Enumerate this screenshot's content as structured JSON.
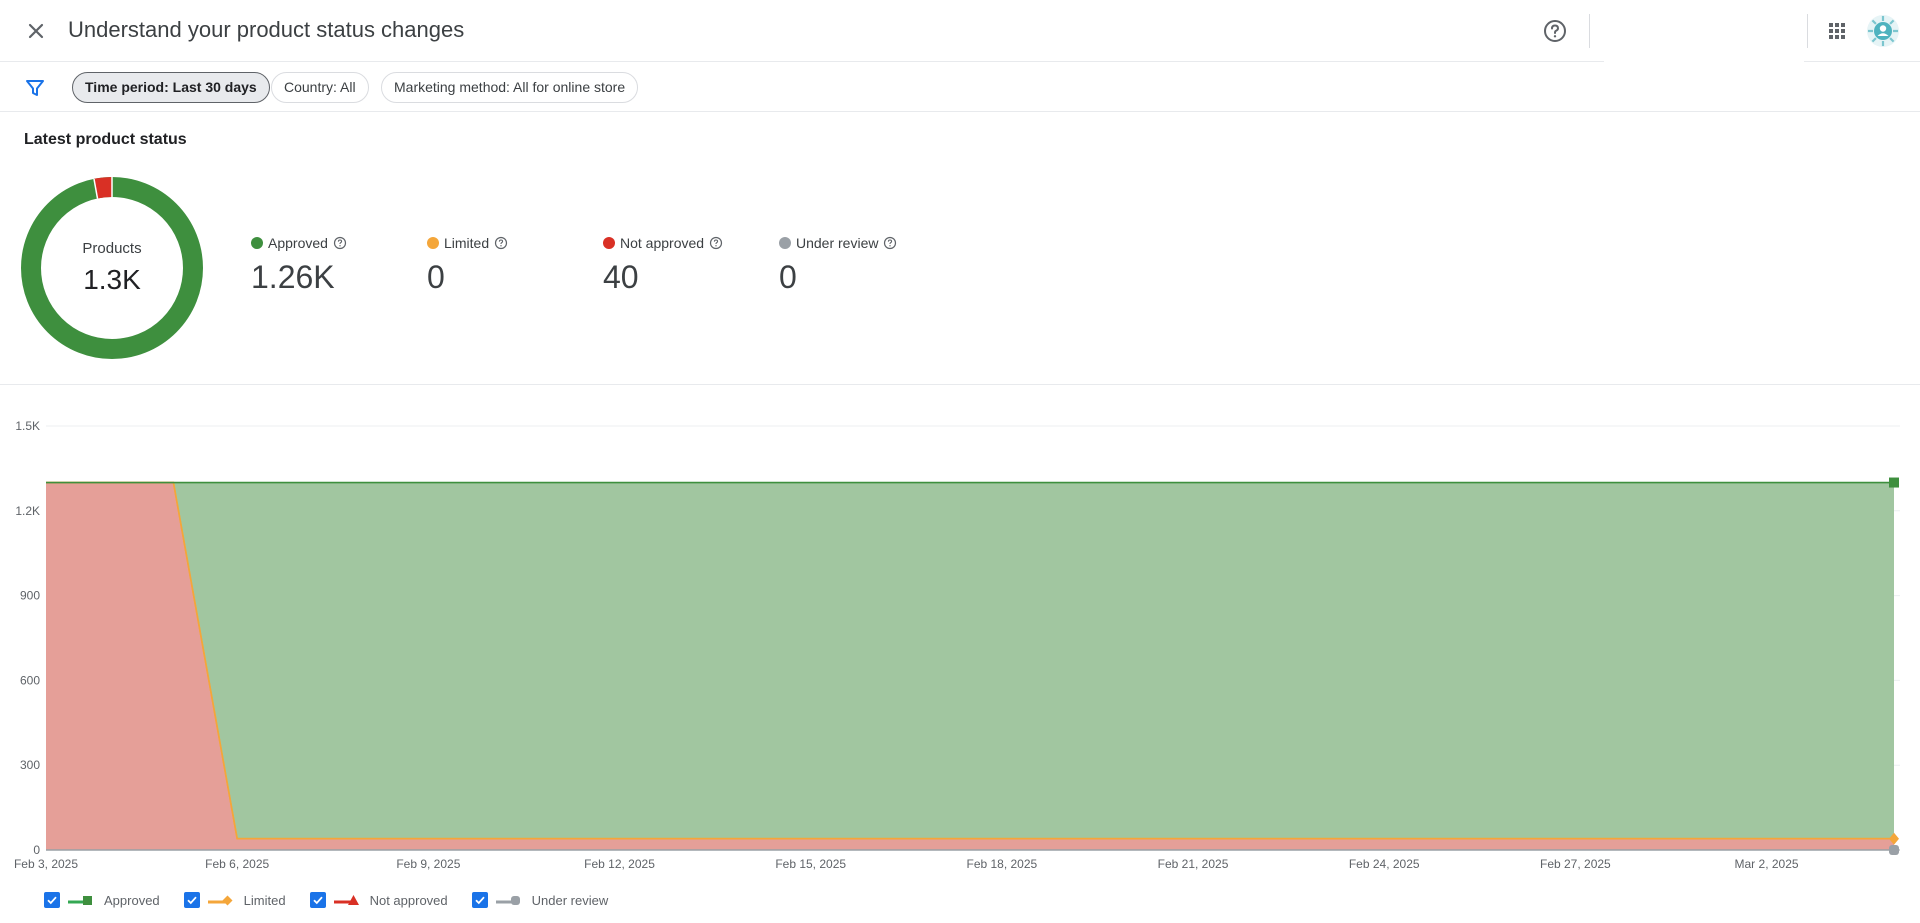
{
  "header": {
    "title": "Understand your product status changes",
    "close_icon": "close-icon",
    "help_icon": "help-circle-icon",
    "apps_icon": "apps-grid-icon"
  },
  "filters": {
    "chips": [
      {
        "label": "Time period: Last 30 days",
        "active": true
      },
      {
        "label": "Country: All",
        "active": false
      },
      {
        "label": "Marketing method: All for online store",
        "active": false
      }
    ]
  },
  "summary": {
    "title": "Latest product status",
    "donut_label": "Products",
    "donut_value": "1.3K",
    "stats": [
      {
        "label": "Approved",
        "value": "1.26K",
        "color": "#34a853"
      },
      {
        "label": "Limited",
        "value": "0",
        "color": "#f4a63a"
      },
      {
        "label": "Not approved",
        "value": "40",
        "color": "#d93025"
      },
      {
        "label": "Under review",
        "value": "0",
        "color": "#9aa0a6"
      }
    ]
  },
  "chart_data": {
    "type": "area",
    "stacked": true,
    "x": [
      "Feb 3, 2025",
      "Feb 4, 2025",
      "Feb 5, 2025",
      "Feb 6, 2025",
      "Feb 7, 2025",
      "Feb 8, 2025",
      "Feb 9, 2025",
      "Feb 10, 2025",
      "Feb 11, 2025",
      "Feb 12, 2025",
      "Feb 13, 2025",
      "Feb 14, 2025",
      "Feb 15, 2025",
      "Feb 16, 2025",
      "Feb 17, 2025",
      "Feb 18, 2025",
      "Feb 19, 2025",
      "Feb 20, 2025",
      "Feb 21, 2025",
      "Feb 22, 2025",
      "Feb 23, 2025",
      "Feb 24, 2025",
      "Feb 25, 2025",
      "Feb 26, 2025",
      "Feb 27, 2025",
      "Feb 28, 2025",
      "Mar 1, 2025",
      "Mar 2, 2025",
      "Mar 3, 2025",
      "Mar 4, 2025"
    ],
    "x_ticks": [
      "Feb 3, 2025",
      "Feb 6, 2025",
      "Feb 9, 2025",
      "Feb 12, 2025",
      "Feb 15, 2025",
      "Feb 18, 2025",
      "Feb 21, 2025",
      "Feb 24, 2025",
      "Feb 27, 2025",
      "Mar 2, 2025"
    ],
    "y_ticks": [
      "0",
      "300",
      "600",
      "900",
      "1.2K",
      "1.5K"
    ],
    "ylim": [
      0,
      1500
    ],
    "grid": true,
    "legend_position": "bottom-left",
    "series": [
      {
        "name": "Approved",
        "color": "#34a853",
        "values": [
          0,
          0,
          0,
          1260,
          1260,
          1260,
          1260,
          1260,
          1260,
          1260,
          1260,
          1260,
          1260,
          1260,
          1260,
          1260,
          1260,
          1260,
          1260,
          1260,
          1260,
          1260,
          1260,
          1260,
          1260,
          1260,
          1260,
          1260,
          1260,
          1260
        ]
      },
      {
        "name": "Limited",
        "color": "#f4a63a",
        "values": [
          0,
          0,
          0,
          0,
          0,
          0,
          0,
          0,
          0,
          0,
          0,
          0,
          0,
          0,
          0,
          0,
          0,
          0,
          0,
          0,
          0,
          0,
          0,
          0,
          0,
          0,
          0,
          0,
          0,
          0
        ]
      },
      {
        "name": "Not approved",
        "color": "#d93025",
        "values": [
          1300,
          1300,
          1300,
          40,
          40,
          40,
          40,
          40,
          40,
          40,
          40,
          40,
          40,
          40,
          40,
          40,
          40,
          40,
          40,
          40,
          40,
          40,
          40,
          40,
          40,
          40,
          40,
          40,
          40,
          40
        ]
      },
      {
        "name": "Under review",
        "color": "#9aa0a6",
        "values": [
          0,
          0,
          0,
          0,
          0,
          0,
          0,
          0,
          0,
          0,
          0,
          0,
          0,
          0,
          0,
          0,
          0,
          0,
          0,
          0,
          0,
          0,
          0,
          0,
          0,
          0,
          0,
          0,
          0,
          0
        ]
      }
    ]
  },
  "legend": {
    "items": [
      {
        "label": "Approved",
        "color": "#34a853",
        "marker": "square"
      },
      {
        "label": "Limited",
        "color": "#f4a63a",
        "marker": "diamond"
      },
      {
        "label": "Not approved",
        "color": "#d93025",
        "marker": "triangle"
      },
      {
        "label": "Under review",
        "color": "#9aa0a6",
        "marker": "circle"
      }
    ]
  }
}
